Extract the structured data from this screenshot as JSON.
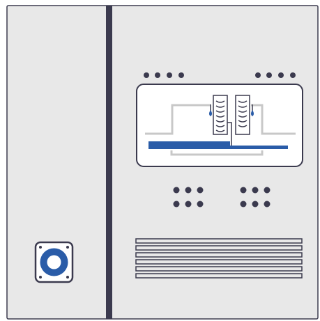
{
  "panel": {
    "body_color": "#e8e8e8",
    "outline_color": "#3b3a4e",
    "divider_color": "#3b3a4e",
    "accent_color": "#2a5ca8",
    "schematic_line_color": "#c8c8c8",
    "window_fill": "#ffffff"
  },
  "indicator_groups": {
    "top_row_left_count": 4,
    "top_row_right_count": 4,
    "middle_grid_left": {
      "rows": 2,
      "cols": 3
    },
    "middle_grid_right": {
      "rows": 2,
      "cols": 3
    }
  },
  "vent": {
    "slat_count": 6
  },
  "icons": {
    "left_fixture": "speaker-port-icon",
    "window_sprayers": "water-drop-icon"
  }
}
